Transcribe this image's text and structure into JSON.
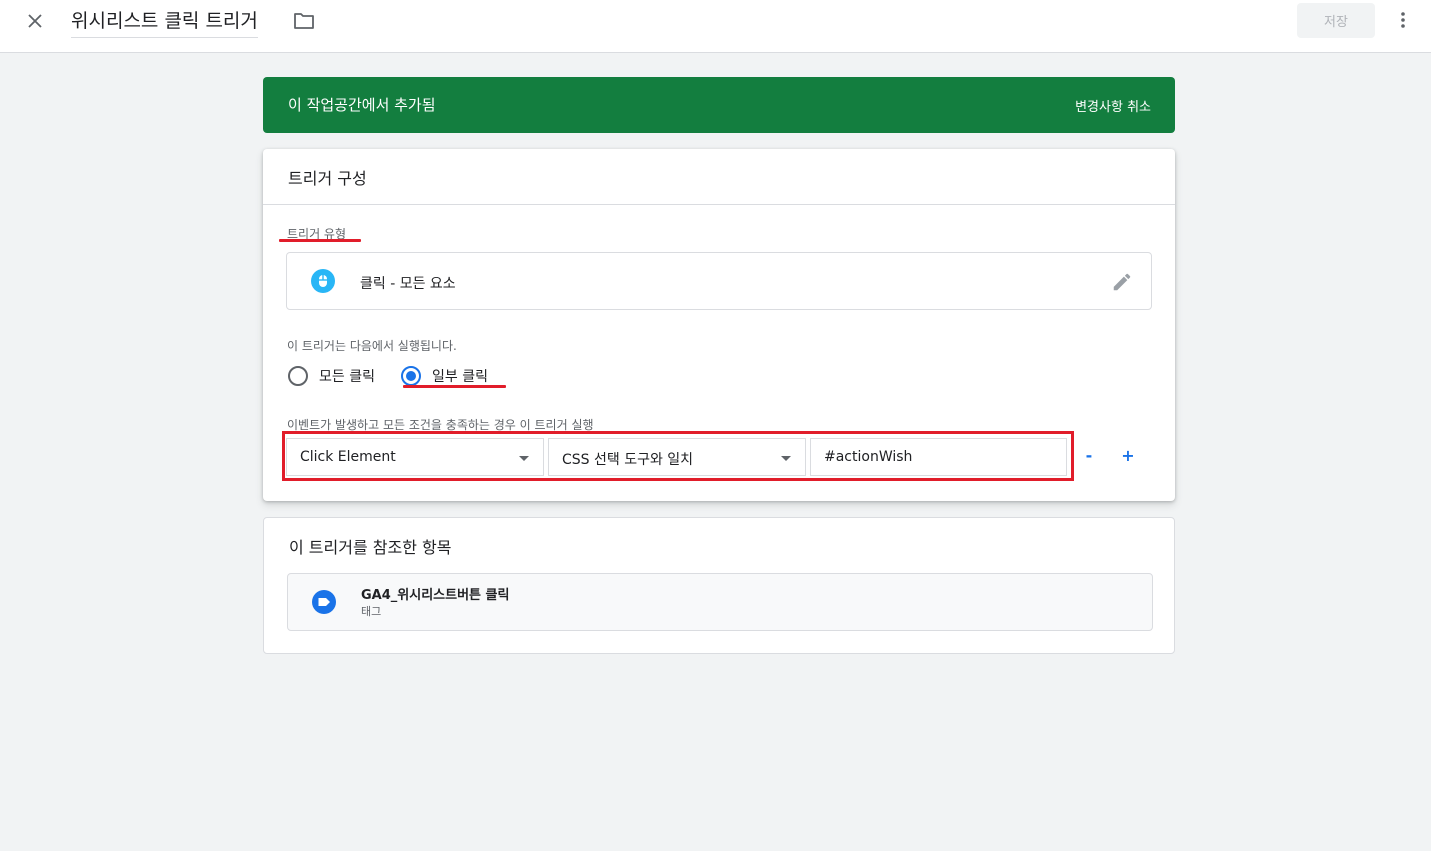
{
  "topbar": {
    "title": "위시리스트 클릭 트리거",
    "save_label": "저장"
  },
  "banner": {
    "message": "이 작업공간에서 추가됨",
    "action_label": "변경사항 취소",
    "color": "#137e3f"
  },
  "trigger_config": {
    "title": "트리거 구성",
    "type_label": "트리거 유형",
    "type_value": "클릭 - 모든 요소",
    "fire_on_label": "이 트리거는 다음에서 실행됩니다.",
    "radio_options": [
      {
        "label": "모든 클릭",
        "selected": false
      },
      {
        "label": "일부 클릭",
        "selected": true
      }
    ],
    "condition_label": "이벤트가 발생하고 모든 조건을 충족하는 경우 이 트리거 실행",
    "condition": {
      "variable": "Click Element",
      "operator": "CSS 선택 도구와 일치",
      "value": "#actionWish"
    },
    "remove_label": "-",
    "add_label": "+"
  },
  "references": {
    "title": "이 트리거를 참조한 항목",
    "items": [
      {
        "name": "GA4_위시리스트버튼 클릭",
        "type": "태그"
      }
    ]
  },
  "colors": {
    "accent": "#1a73e8",
    "highlight": "#e11d2a",
    "icon_blue": "#1a73e8",
    "mouse_icon": "#29b6f6"
  }
}
